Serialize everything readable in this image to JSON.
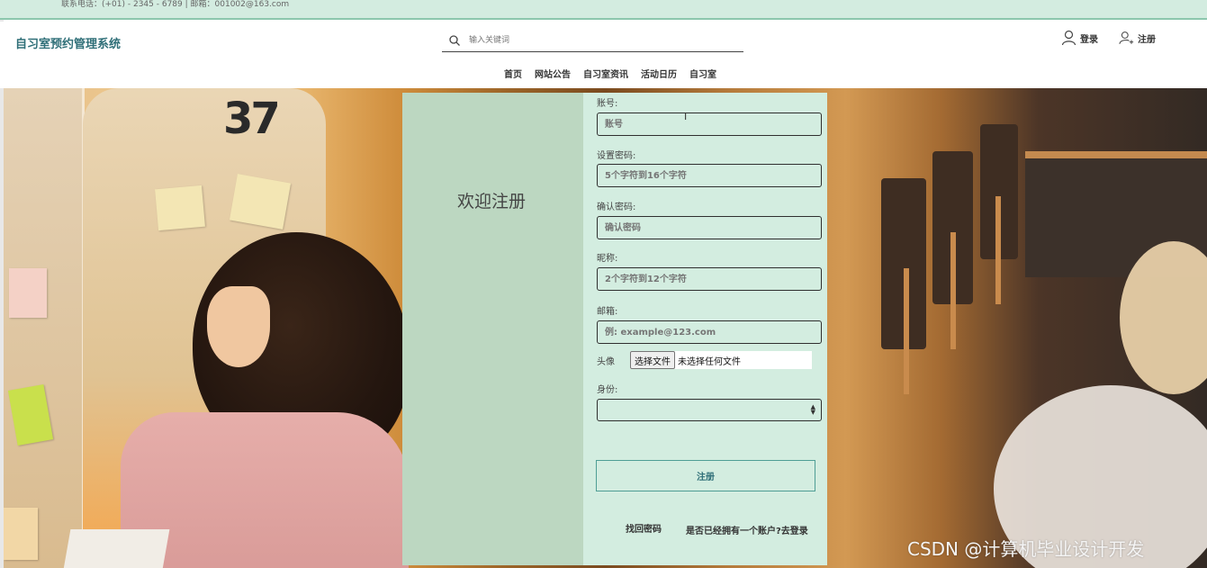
{
  "topbar": {
    "contact": "联系电话：(+01) - 2345 - 6789 | 邮箱：001002@163.com"
  },
  "header": {
    "site_title": "自习室预约管理系统",
    "search_placeholder": "输入关键词",
    "login_label": "登录",
    "register_label": "注册"
  },
  "nav": {
    "items": [
      "首页",
      "网站公告",
      "自习室资讯",
      "活动日历",
      "自习室"
    ]
  },
  "hero": {
    "seat_number": "37"
  },
  "register": {
    "welcome": "欢迎注册",
    "account_label": "账号:",
    "account_placeholder": "账号",
    "password_label": "设置密码:",
    "password_placeholder": "5个字符到16个字符",
    "confirm_label": "确认密码:",
    "confirm_placeholder": "确认密码",
    "nickname_label": "昵称:",
    "nickname_placeholder": "2个字符到12个字符",
    "email_label": "邮箱:",
    "email_placeholder": "例: example@123.com",
    "avatar_label": "头像",
    "file_button": "选择文件",
    "file_status": "未选择任何文件",
    "role_label": "身份:",
    "role_value": "",
    "submit_label": "注册",
    "find_password": "找回密码",
    "have_account": "是否已经拥有一个账户?去登录"
  },
  "watermark": "CSDN @计算机毕业设计开发",
  "colors": {
    "accent": "#2f6f78",
    "panel_left": "#bcd7c1",
    "panel_right": "#d3ede0",
    "topbar": "#d3ece0"
  }
}
